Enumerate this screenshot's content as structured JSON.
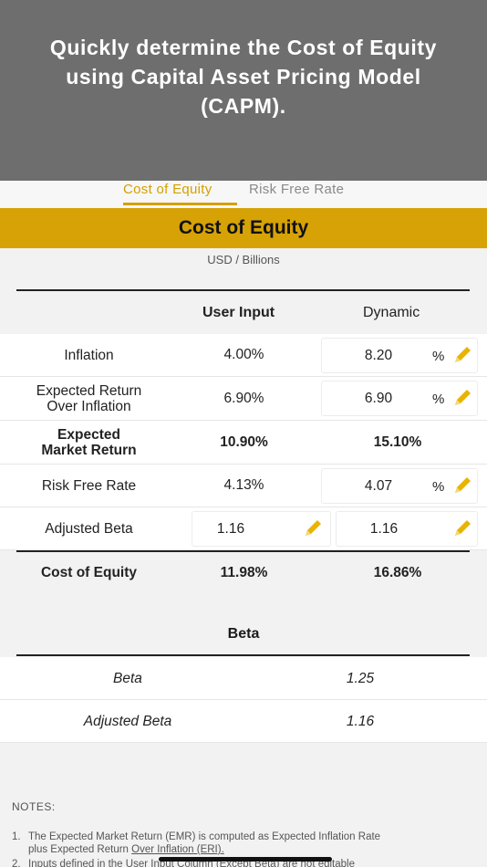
{
  "banner": {
    "title_line1": "Quickly determine the Cost of Equity",
    "title_line2": "using Capital Asset Pricing Model",
    "title_line3": "(CAPM)."
  },
  "tabs": [
    "Cost of Equity",
    "Risk Free Rate"
  ],
  "header": {
    "title": "Cost of Equity",
    "units": "USD / Billions"
  },
  "columns": {
    "user": "User Input",
    "dynamic": "Dynamic"
  },
  "rows": {
    "inflation": {
      "label": "Inflation",
      "user": "4.00%",
      "dynamic": "8.20",
      "unit": "%"
    },
    "expected_return": {
      "label_line1": "Expected Return",
      "label_line2": "Over Inflation",
      "user": "6.90%",
      "dynamic": "6.90",
      "unit": "%"
    },
    "market_return": {
      "label_line1": "Expected",
      "label_line2": "Market Return",
      "user": "10.90%",
      "dynamic": "15.10%"
    },
    "risk_free": {
      "label": "Risk Free Rate",
      "user": "4.13%",
      "dynamic": "4.07",
      "unit": "%"
    },
    "adjusted_beta": {
      "label": "Adjusted Beta",
      "user": "1.16",
      "dynamic": "1.16"
    },
    "cost_of_equity": {
      "label": "Cost of Equity",
      "user": "11.98%",
      "dynamic": "16.86%"
    }
  },
  "beta_section": {
    "title": "Beta",
    "beta_label": "Beta",
    "beta_value": "1.25",
    "adjusted_label": "Adjusted Beta",
    "adjusted_value": "1.16"
  },
  "notes": {
    "title": "NOTES:",
    "item1_num": "1.",
    "item1_line1": "The Expected Market Return (EMR) is computed as Expected Inflation Rate",
    "item1_line2_a": "plus Expected Return ",
    "item1_line2_b": "Over Inflation (ERI).",
    "item2_num": "2.",
    "item2_text": "Inputs defined in the User Input Column (Except Beta) are not editable"
  },
  "colors": {
    "accent": "#d6a206",
    "tab_active": "#d4a000",
    "banner": "#6e6e6e",
    "pencil": "#e8b400"
  },
  "icons": {
    "edit": "pencil-icon"
  }
}
